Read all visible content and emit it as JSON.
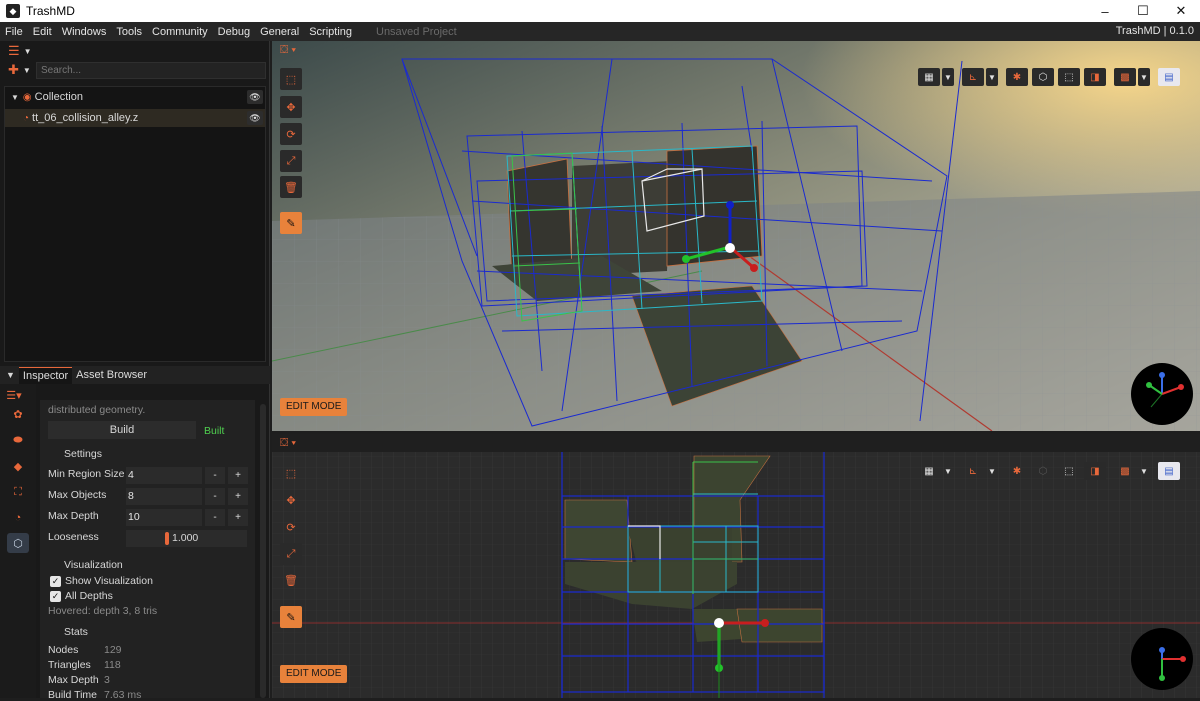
{
  "window": {
    "title": "TrashMD",
    "minimize": "–",
    "maximize": "☐",
    "close": "✕"
  },
  "menu": {
    "items": [
      "File",
      "Edit",
      "Windows",
      "Tools",
      "Community",
      "Debug",
      "General",
      "Scripting"
    ],
    "project": "Unsaved Project",
    "version": "TrashMD | 0.1.0"
  },
  "scene": {
    "search_placeholder": "Search...",
    "collection_label": "Collection",
    "item_label": "tt_06_collision_alley.z"
  },
  "inspector": {
    "tabs": [
      "Inspector",
      "Asset Browser"
    ],
    "description": "distributed geometry.",
    "build_label": "Build",
    "build_status": "Built",
    "settings_header": "Settings",
    "settings": {
      "min_region_label": "Min Region Size",
      "min_region": "4",
      "max_objects_label": "Max Objects",
      "max_objects": "8",
      "max_depth_label": "Max Depth",
      "max_depth": "10",
      "looseness_label": "Looseness",
      "looseness": "1.000"
    },
    "visualization_header": "Visualization",
    "show_visualization": "Show Visualization",
    "all_depths": "All Depths",
    "hovered": "Hovered: depth 3, 8 tris",
    "stats_header": "Stats",
    "stats": [
      {
        "label": "Nodes",
        "value": "129"
      },
      {
        "label": "Triangles",
        "value": "118"
      },
      {
        "label": "Max Depth",
        "value": "3"
      },
      {
        "label": "Build Time",
        "value": "7.63 ms"
      }
    ],
    "minus": "-",
    "plus": "+"
  },
  "viewports": {
    "edit_mode_label": "EDIT MODE"
  },
  "colors": {
    "accent": "#e8683b",
    "grid_blue": "#1a2ad0",
    "grid_cyan": "#2ab8c8",
    "grid_green": "#3ac24a"
  }
}
